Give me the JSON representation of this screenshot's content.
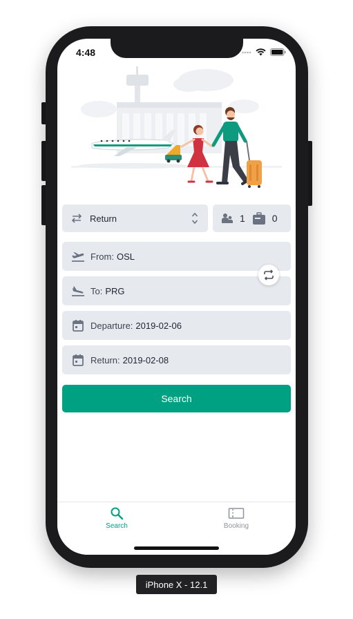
{
  "status_bar": {
    "time": "4:48"
  },
  "trip": {
    "type_label": "Return"
  },
  "passengers": {
    "adults": "1",
    "bags": "0"
  },
  "fields": {
    "from_label": "From:",
    "from_value": "OSL",
    "to_label": "To:",
    "to_value": "PRG",
    "departure_label": "Departure:",
    "departure_value": "2019-02-06",
    "return_label": "Return:",
    "return_value": "2019-02-08"
  },
  "search_button": {
    "label": "Search"
  },
  "tabs": [
    {
      "label": "Search",
      "icon": "search-icon",
      "active": true
    },
    {
      "label": "Booking",
      "icon": "ticket-icon",
      "active": false
    }
  ],
  "device_label": "iPhone X - 12.1",
  "colors": {
    "accent": "#00a082",
    "field_bg": "#e6e9ee",
    "icon": "#6b7383"
  }
}
